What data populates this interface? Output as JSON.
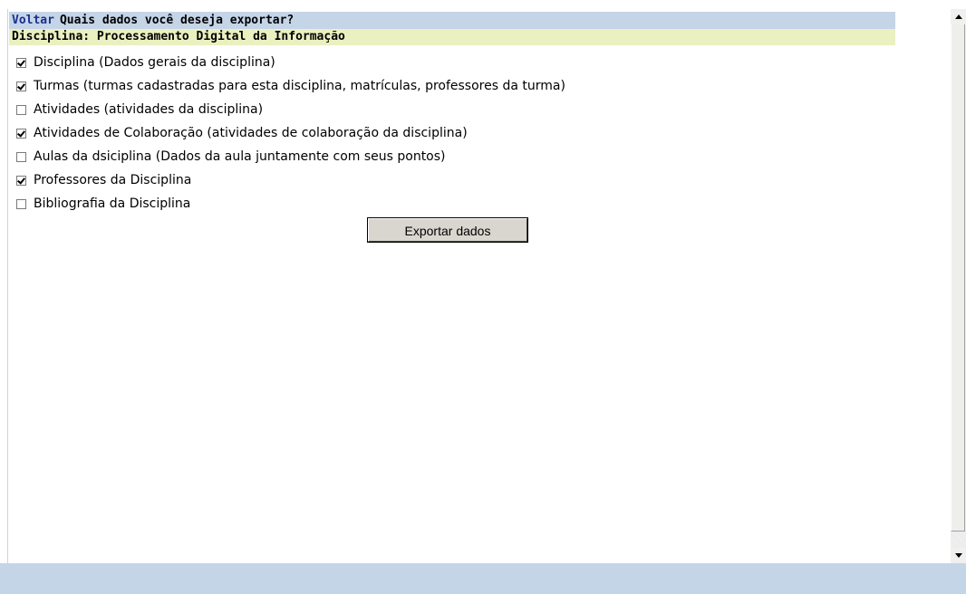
{
  "header": {
    "back_link": "Voltar",
    "question": "Quais dados você deseja exportar?"
  },
  "subject": {
    "label": "Disciplina: Processamento Digital da Informação"
  },
  "options": [
    {
      "label": "Disciplina (Dados gerais da disciplina)",
      "checked": true
    },
    {
      "label": "Turmas (turmas cadastradas para esta disciplina, matrículas, professores da turma)",
      "checked": true
    },
    {
      "label": "Atividades (atividades da disciplina)",
      "checked": false
    },
    {
      "label": "Atividades de Colaboração (atividades de colaboração da disciplina)",
      "checked": true
    },
    {
      "label": "Aulas da dsiciplina (Dados da aula juntamente com seus pontos)",
      "checked": false
    },
    {
      "label": "Professores da Disciplina",
      "checked": true
    },
    {
      "label": "Bibliografia da Disciplina",
      "checked": false
    }
  ],
  "actions": {
    "export_label": "Exportar dados"
  },
  "colors": {
    "header_bg": "#c5d5e8",
    "subject_bg": "#eaf0c0",
    "link": "#1a2f8e"
  }
}
